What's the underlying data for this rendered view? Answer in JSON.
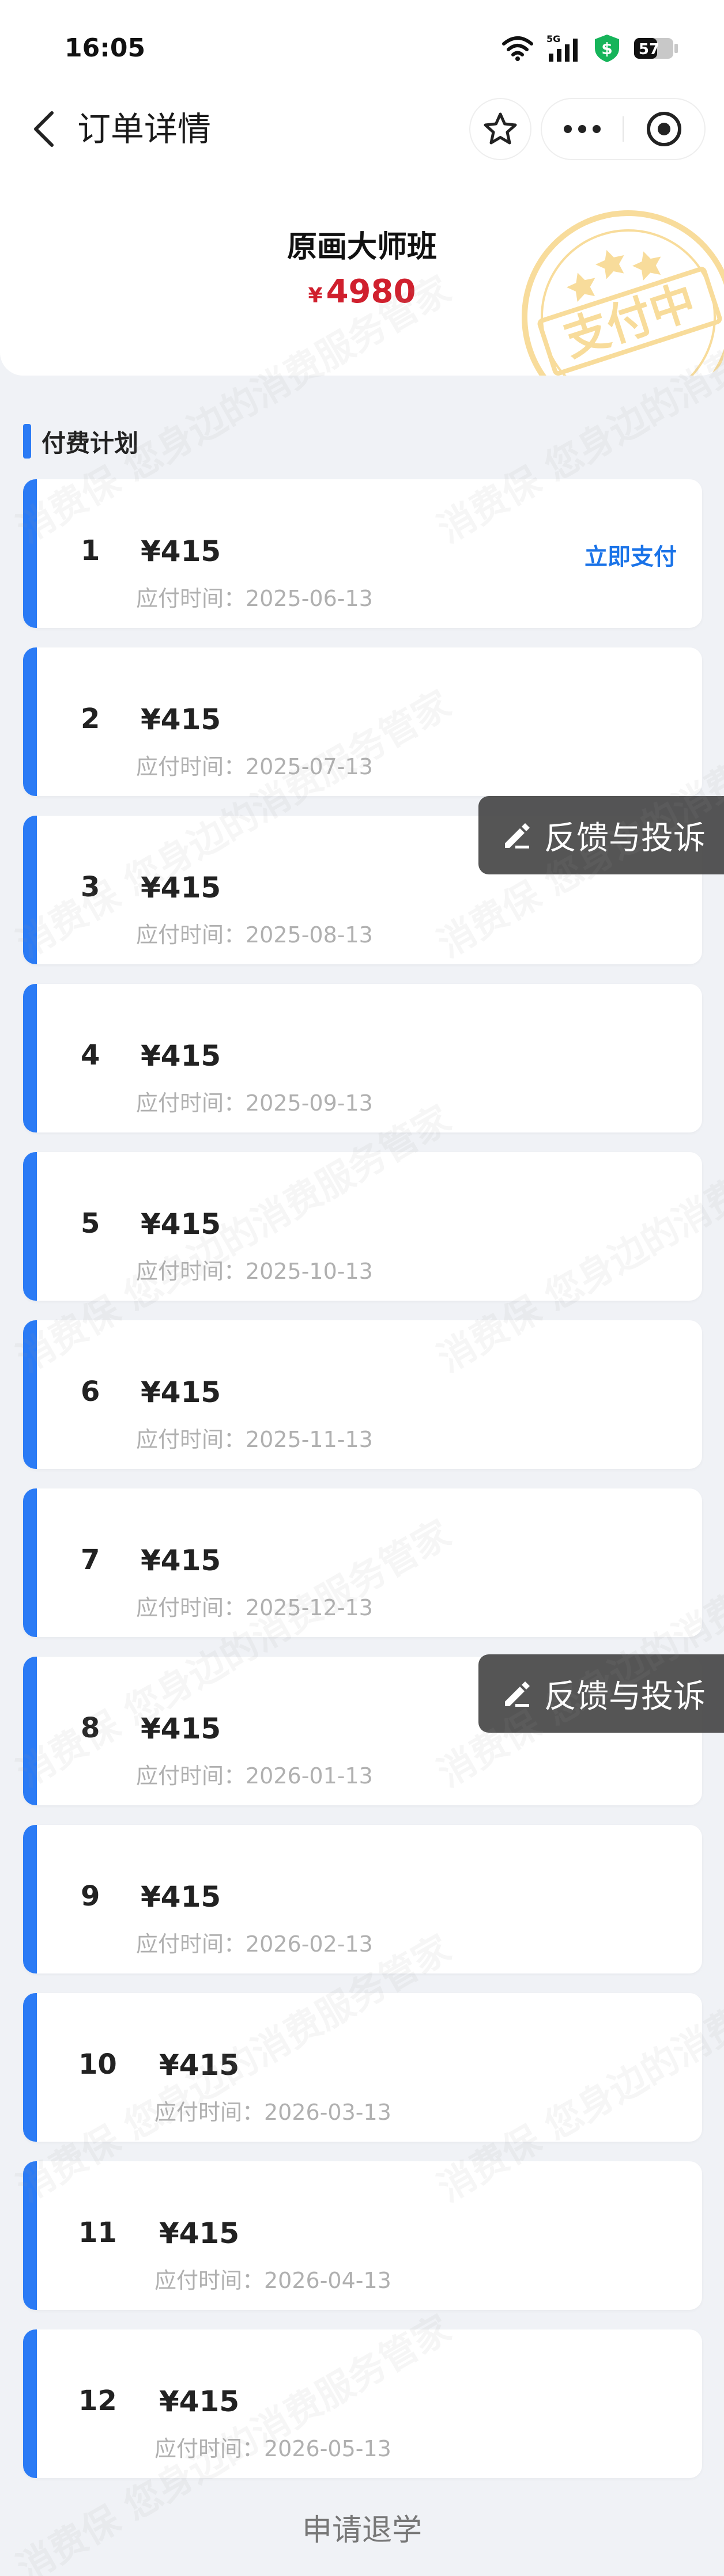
{
  "status_bar": {
    "time": "16:05",
    "network": "5G",
    "battery": "57"
  },
  "nav": {
    "title": "订单详情"
  },
  "course": {
    "title": "原画大师班",
    "currency_symbol": "¥",
    "price": "4980"
  },
  "stamp_text": "支付中",
  "watermark_text": "消费保 您身边的消费服务管家",
  "section": {
    "title": "付费计划"
  },
  "plan": {
    "due_label": "应付时间：",
    "pay_now_label": "立即支付",
    "items": [
      {
        "index": "1",
        "amount": "¥415",
        "due": "应付时间：2025-06-13"
      },
      {
        "index": "2",
        "amount": "¥415",
        "due": "应付时间：2025-07-13"
      },
      {
        "index": "3",
        "amount": "¥415",
        "due": "应付时间：2025-08-13"
      },
      {
        "index": "4",
        "amount": "¥415",
        "due": "应付时间：2025-09-13"
      },
      {
        "index": "5",
        "amount": "¥415",
        "due": "应付时间：2025-10-13"
      },
      {
        "index": "6",
        "amount": "¥415",
        "due": "应付时间：2025-11-13"
      },
      {
        "index": "7",
        "amount": "¥415",
        "due": "应付时间：2025-12-13"
      },
      {
        "index": "8",
        "amount": "¥415",
        "due": "应付时间：2026-01-13"
      },
      {
        "index": "9",
        "amount": "¥415",
        "due": "应付时间：2026-02-13"
      },
      {
        "index": "10",
        "amount": "¥415",
        "due": "应付时间：2026-03-13"
      },
      {
        "index": "11",
        "amount": "¥415",
        "due": "应付时间：2026-04-13"
      },
      {
        "index": "12",
        "amount": "¥415",
        "due": "应付时间：2026-05-13"
      }
    ]
  },
  "feedback": {
    "label": "反馈与投诉"
  },
  "footer": {
    "withdraw_label": "申请退学"
  },
  "colors": {
    "accent": "#2b7bf5",
    "price": "#d0202e",
    "link": "#1a73e8",
    "stamp": "#f0b429"
  },
  "icons": [
    "wifi-icon",
    "signal-icon",
    "shield-icon",
    "battery-icon",
    "back-arrow-icon",
    "star-icon",
    "more-icon",
    "target-icon",
    "edit-icon"
  ]
}
